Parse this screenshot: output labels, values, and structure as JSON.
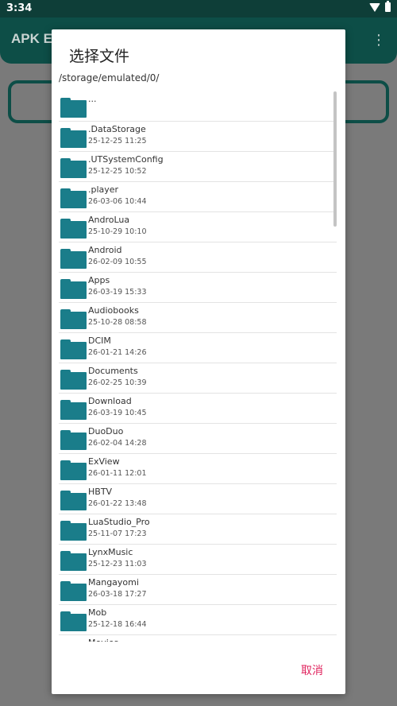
{
  "status_bar": {
    "time": "3:34"
  },
  "app": {
    "title": "APK E"
  },
  "dialog": {
    "title": "选择文件",
    "path": "/storage/emulated/0/",
    "cancel_label": "取消",
    "items": [
      {
        "name": "...",
        "date": ""
      },
      {
        "name": ".DataStorage",
        "date": "25-12-25 11:25"
      },
      {
        "name": ".UTSystemConfig",
        "date": "25-12-25 10:52"
      },
      {
        "name": ".player",
        "date": "26-03-06 10:44"
      },
      {
        "name": "AndroLua",
        "date": "25-10-29 10:10"
      },
      {
        "name": "Android",
        "date": "26-02-09 10:55"
      },
      {
        "name": "Apps",
        "date": "26-03-19 15:33"
      },
      {
        "name": "Audiobooks",
        "date": "25-10-28 08:58"
      },
      {
        "name": "DCIM",
        "date": "26-01-21 14:26"
      },
      {
        "name": "Documents",
        "date": "26-02-25 10:39"
      },
      {
        "name": "Download",
        "date": "26-03-19 10:45"
      },
      {
        "name": "DuoDuo",
        "date": "26-02-04 14:28"
      },
      {
        "name": "ExView",
        "date": "26-01-11 12:01"
      },
      {
        "name": "HBTV",
        "date": "26-01-22 13:48"
      },
      {
        "name": "LuaStudio_Pro",
        "date": "25-11-07 17:23"
      },
      {
        "name": "LynxMusic",
        "date": "25-12-23 11:03"
      },
      {
        "name": "Mangayomi",
        "date": "26-03-18 17:27"
      },
      {
        "name": "Mob",
        "date": "25-12-18 16:44"
      },
      {
        "name": "Movies",
        "date": ""
      }
    ]
  },
  "colors": {
    "folder": "#1a7d8a",
    "accent": "#e0245e",
    "app_bar": "#0d4e47"
  }
}
